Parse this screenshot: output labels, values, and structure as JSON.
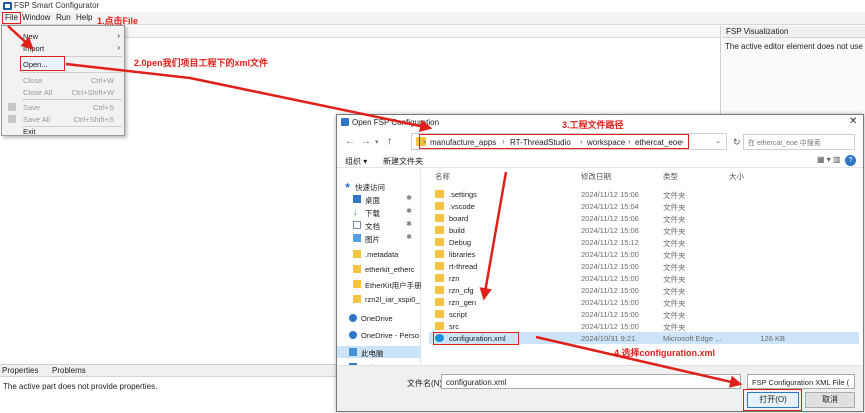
{
  "app": {
    "title": "FSP Smart Configurator"
  },
  "menubar": {
    "file": "File",
    "window": "Window",
    "run": "Run",
    "help": "Help"
  },
  "file_menu": {
    "items": [
      {
        "label": "New",
        "shortcut": "",
        "submenu": "›",
        "disabled": false
      },
      {
        "label": "Import",
        "shortcut": "",
        "submenu": "›",
        "disabled": false
      },
      {
        "label": "Open...",
        "shortcut": "",
        "disabled": false
      },
      {
        "label": "Close",
        "shortcut": "Ctrl+W",
        "disabled": true
      },
      {
        "label": "Close All",
        "shortcut": "Ctrl+Shift+W",
        "disabled": true
      },
      {
        "label": "Save",
        "shortcut": "Ctrl+S",
        "disabled": true
      },
      {
        "label": "Save All",
        "shortcut": "Ctrl+Shift+S",
        "disabled": true
      },
      {
        "label": "Exit",
        "shortcut": "",
        "disabled": false
      }
    ]
  },
  "right_panel": {
    "title": "FSP Visualization",
    "message": "The active editor element does not use this"
  },
  "bottom_panel": {
    "tab_properties": "Properties",
    "tab_problems": "Problems",
    "message": "The active part does not provide properties."
  },
  "annotations": {
    "step1": "1.点击File",
    "step2": "2.0pen我们项目工程下的xml文件",
    "step3": "3.工程文件路径",
    "step4": "4.选择configuration.xml"
  },
  "dialog": {
    "title": "Open FSP Configuration",
    "close": "✕",
    "breadcrumbs": [
      "manufacture_apps",
      "RT-ThreadStudio",
      "workspace",
      "ethercat_eoe"
    ],
    "search_placeholder": "在 ethercat_eoe 中搜索",
    "cmd_organize": "组织 ▾",
    "cmd_newfolder": "新建文件夹",
    "nav": [
      {
        "label": "快速访问",
        "icon": "star-icon"
      },
      {
        "label": "桌面",
        "icon": "desktop-icon",
        "pinned": true
      },
      {
        "label": "下载",
        "icon": "download-icon",
        "pinned": true
      },
      {
        "label": "文档",
        "icon": "document-icon",
        "pinned": true
      },
      {
        "label": "图片",
        "icon": "pictures-icon",
        "pinned": true
      },
      {
        "label": ".metadata",
        "icon": "folder-icon"
      },
      {
        "label": "etherkit_etherc",
        "icon": "folder-icon"
      },
      {
        "label": "EtherKit用户手册",
        "icon": "folder-icon"
      },
      {
        "label": "rzn2l_iar_xspi0_",
        "icon": "folder-icon"
      },
      {
        "label": "OneDrive",
        "icon": "cloud-icon"
      },
      {
        "label": "OneDrive - Perso",
        "icon": "cloud-icon"
      },
      {
        "label": "此电脑",
        "icon": "computer-icon"
      },
      {
        "label": "网络",
        "icon": "network-icon"
      }
    ],
    "columns": {
      "name": "名称",
      "date": "修改日期",
      "type": "类型",
      "size": "大小"
    },
    "files": [
      {
        "name": ".settings",
        "date": "2024/11/12 15:06",
        "type": "文件夹",
        "size": ""
      },
      {
        "name": ".vscode",
        "date": "2024/11/12 15:04",
        "type": "文件夹",
        "size": ""
      },
      {
        "name": "board",
        "date": "2024/11/12 15:06",
        "type": "文件夹",
        "size": ""
      },
      {
        "name": "build",
        "date": "2024/11/12 15:06",
        "type": "文件夹",
        "size": ""
      },
      {
        "name": "Debug",
        "date": "2024/11/12 15:12",
        "type": "文件夹",
        "size": ""
      },
      {
        "name": "libraries",
        "date": "2024/11/12 15:00",
        "type": "文件夹",
        "size": ""
      },
      {
        "name": "rt-thread",
        "date": "2024/11/12 15:00",
        "type": "文件夹",
        "size": ""
      },
      {
        "name": "rzn",
        "date": "2024/11/12 15:00",
        "type": "文件夹",
        "size": ""
      },
      {
        "name": "rzn_cfg",
        "date": "2024/11/12 15:00",
        "type": "文件夹",
        "size": ""
      },
      {
        "name": "rzn_gen",
        "date": "2024/11/12 15:00",
        "type": "文件夹",
        "size": ""
      },
      {
        "name": "script",
        "date": "2024/11/12 15:00",
        "type": "文件夹",
        "size": ""
      },
      {
        "name": "src",
        "date": "2024/11/12 15:00",
        "type": "文件夹",
        "size": ""
      },
      {
        "name": "configuration.xml",
        "date": "2024/10/31 9:21",
        "type": "Microsoft Edge ...",
        "size": "126 KB",
        "selected": true
      }
    ],
    "filename_label": "文件名(N):",
    "filename_value": "configuration.xml",
    "filter_value": "FSP Configuration XML File (",
    "open_button": "打开(O)",
    "cancel_button": "取消"
  }
}
